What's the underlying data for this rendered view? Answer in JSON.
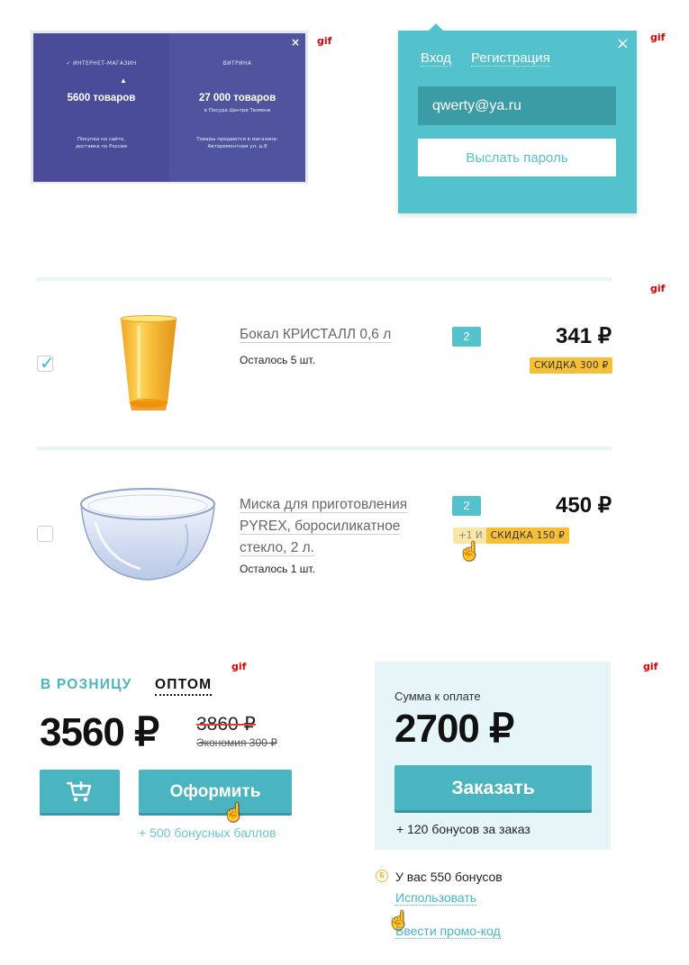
{
  "labels": {
    "gif": "gif"
  },
  "store_switch": {
    "close": "×",
    "pointer": "▲",
    "online": {
      "caption": "✓  ИНТЕРНЕТ-МАГАЗИН",
      "count": "5600 товаров",
      "desc_1": "Покупка на сайте,",
      "desc_2": "доставка по России"
    },
    "showcase": {
      "caption": "ВИТРИНА",
      "count": "27 000 товаров",
      "sub": "в Посуда Центре Тюмени",
      "desc_1": "Товары продаются в магазине:",
      "desc_2": "Авторемонтная ул. д.8"
    }
  },
  "login_popup": {
    "tab_login": "Вход",
    "tab_register": "Регистрация",
    "close": "×",
    "email_value": "qwerty@ya.ru",
    "send_button": "Выслать пароль"
  },
  "cart": {
    "items": [
      {
        "name": "Бокал КРИСТАЛЛ 0,6 л",
        "stock": "Осталось 5 шт.",
        "qty": "2",
        "price": "341 ₽",
        "discount": "СКИДКА 300 ₽",
        "checked": true,
        "check_mark": "✓"
      },
      {
        "name_line_1": "Миска для приготовления",
        "name_line_2": "PYREX, боросиликатное",
        "name_line_3": "стекло, 2 л.",
        "stock": "Осталось 1 шт.",
        "qty": "2",
        "price": "450 ₽",
        "promo_prefix": "+1 И",
        "discount": "СКИДКА 150 ₽",
        "checked": false
      }
    ]
  },
  "summary_left": {
    "mode_retail": "В РОЗНИЦУ",
    "mode_wholesale": "ОПТОМ",
    "total": "3560 ₽",
    "old_price": "3860 ₽",
    "economy": "Экономия 300 ₽",
    "checkout_button": "Оформить",
    "bonus_note": "+ 500 бонусных баллов"
  },
  "summary_right": {
    "pay_label": "Сумма к оплате",
    "pay_total": "2700 ₽",
    "order_button": "Заказать",
    "bonus_note": "+ 120 бонусов за заказ",
    "coin_symbol": "Б",
    "have_bonus": "У вас 550 бонусов",
    "use_link": "Использовать",
    "promo_link": "Ввести промо-код"
  },
  "icons": {
    "cursor": "hand-cursor-icon",
    "cart": "cart-add-icon"
  },
  "colors": {
    "accent": "#53c2cc",
    "discount": "#f7bf35",
    "gif_label": "#e00000"
  }
}
